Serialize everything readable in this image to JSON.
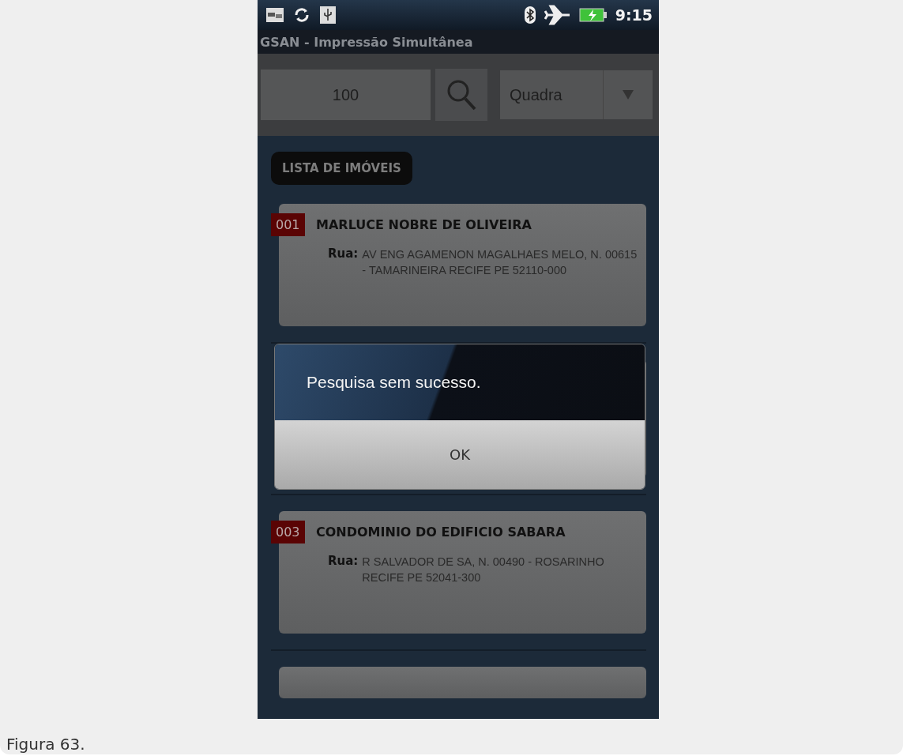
{
  "status_bar": {
    "time": "9:15"
  },
  "app_bar": {
    "title": "GSAN - Impressão Simultânea"
  },
  "search": {
    "value": "100",
    "filter": "Quadra"
  },
  "section_label": "LISTA DE IMÓVEIS",
  "properties": [
    {
      "kind": "card",
      "number": "001",
      "name": "MARLUCE NOBRE DE OLIVEIRA",
      "address_label": "Rua:",
      "address": "AV ENG AGAMENON MAGALHAES MELO, N. 00615 - TAMARINEIRA RECIFE PE 52110-000"
    },
    {
      "kind": "hidden"
    },
    {
      "kind": "card",
      "number": "003",
      "name": "CONDOMINIO DO EDIFICIO SABARA",
      "address_label": "Rua:",
      "address": "R SALVADOR DE SA, N. 00490 - ROSARINHO RECIFE PE 52041-300"
    },
    {
      "kind": "partial"
    }
  ],
  "dialog": {
    "message": "Pesquisa sem sucesso.",
    "buttons": [
      "OK"
    ]
  },
  "caption": "Figura 63."
}
